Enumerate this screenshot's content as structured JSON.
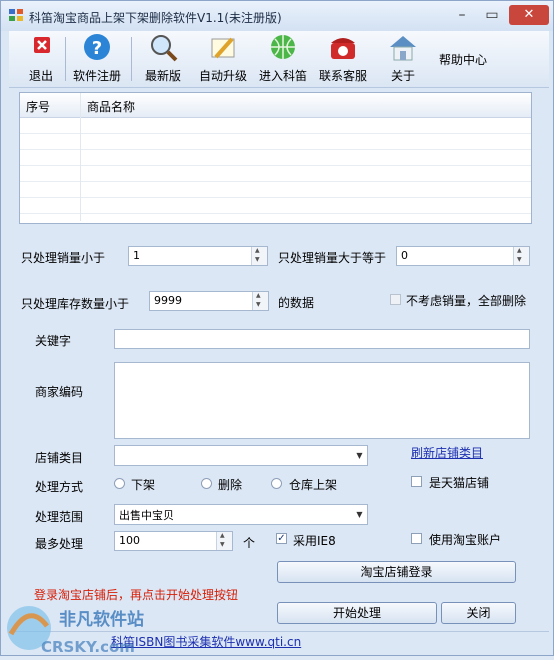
{
  "window": {
    "title": "科笛淘宝商品上架下架删除软件V1.1(未注册版)",
    "min_symbol": "–",
    "max_symbol": "▭",
    "close_symbol": "✕"
  },
  "toolbar": {
    "exit": "退出",
    "register": "软件注册",
    "latest": "最新版",
    "auto_update": "自动升级",
    "enter_site": "进入科笛",
    "contact": "联系客服",
    "about": "关于",
    "help_center": "帮助中心"
  },
  "grid": {
    "columns": [
      "序号",
      "商品名称"
    ],
    "rows": []
  },
  "filters": {
    "sales_lt_label": "只处理销量小于",
    "sales_lt_value": "1",
    "sales_ge_label": "只处理销量大于等于",
    "sales_ge_value": "0",
    "stock_lt_label": "只处理库存数量小于",
    "stock_lt_value": "9999",
    "stock_suffix": "的数据",
    "ignore_sales_label": "不考虑销量，全部删除"
  },
  "fields": {
    "keyword_label": "关键字",
    "keyword_value": "",
    "merchant_code_label": "商家编码",
    "merchant_code_value": "",
    "category_label": "店铺类目",
    "category_value": "",
    "refresh_category_link": "刷新店铺类目",
    "tmall_label": "是天猫店铺"
  },
  "processing": {
    "mode_label": "处理方式",
    "mode_options": [
      "下架",
      "删除",
      "仓库上架"
    ],
    "scope_label": "处理范围",
    "scope_value": "出售中宝贝",
    "max_label": "最多处理",
    "max_value": "100",
    "max_unit": "个",
    "use_ie8_label": "采用IE8",
    "use_ie8_checked": true,
    "use_taobao_account_label": "使用淘宝账户"
  },
  "buttons": {
    "login": "淘宝店铺登录",
    "start": "开始处理",
    "close": "关闭"
  },
  "status": {
    "message": "登录淘宝店铺后，再点击开始处理按钮"
  },
  "footer": {
    "link": "科笛ISBN图书采集软件www.qti.cn"
  },
  "watermark": {
    "text1": "非凡软件站",
    "text2": "CRSKY.com"
  },
  "colors": {
    "status_red": "#d81e06",
    "link_blue": "#1c2fb0",
    "window_bg": "#dce7f5"
  }
}
